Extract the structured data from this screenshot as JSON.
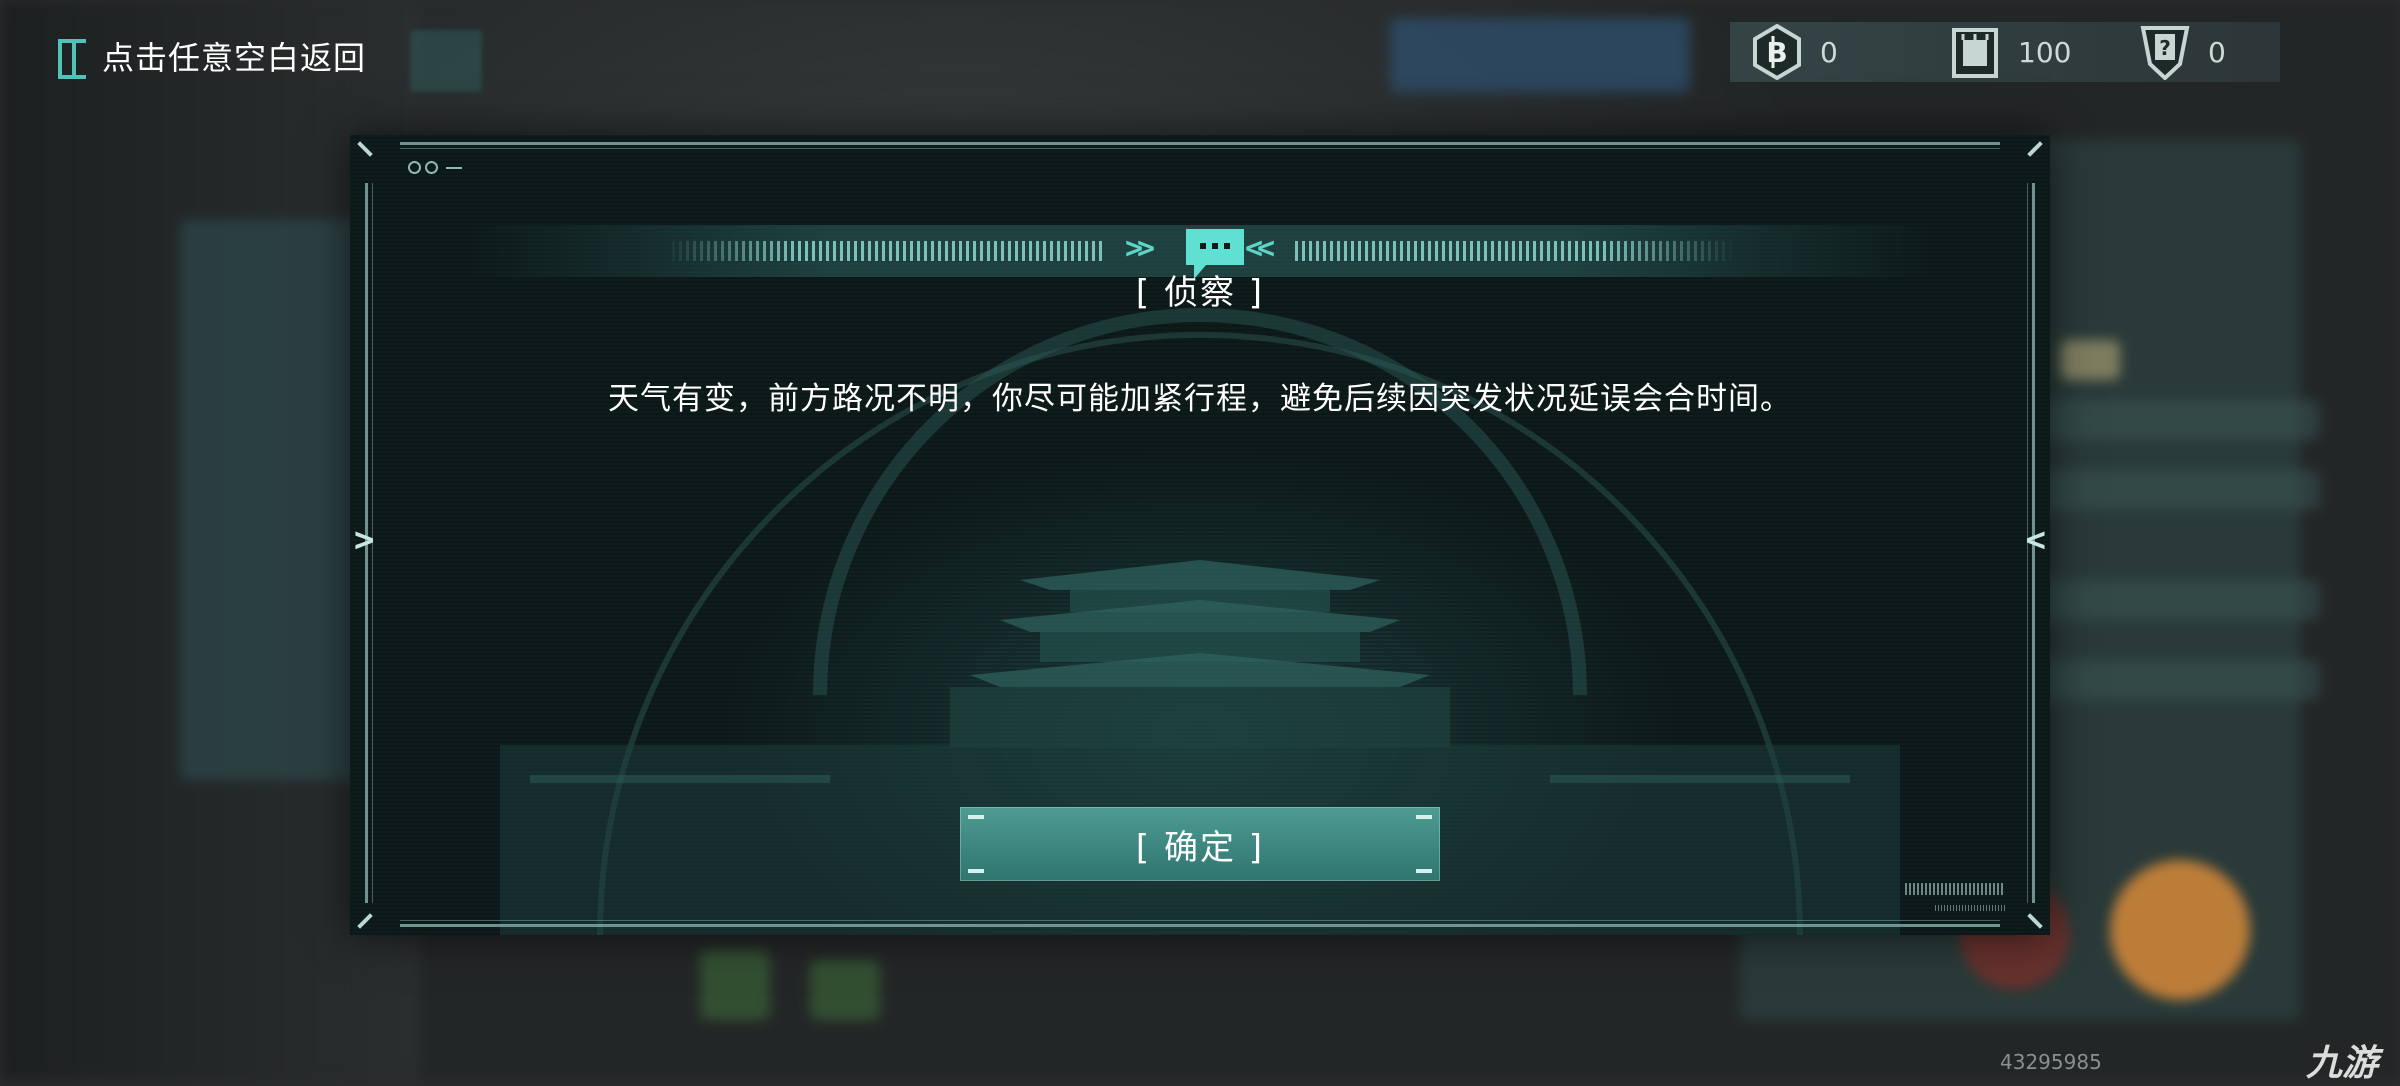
{
  "top_bar": {
    "back_hint": "点击任意空白返回",
    "resources": [
      {
        "icon": "bitcoin-hex-icon",
        "value": "0"
      },
      {
        "icon": "chip-card-icon",
        "value": "100"
      },
      {
        "icon": "question-card-icon",
        "value": "0"
      }
    ]
  },
  "dialog": {
    "title": "[ 侦察 ]",
    "message": "天气有变，前方路况不明，你尽可能加紧行程，避免后续因突发状况延误会合时间。",
    "confirm_label": "[ 确定 ]"
  },
  "watermark": {
    "id": "43295985",
    "logo": "九游"
  },
  "colors": {
    "accent": "#4ec3b6",
    "button": "#3f8a83",
    "dialog_bg": "#0f1b1b"
  }
}
